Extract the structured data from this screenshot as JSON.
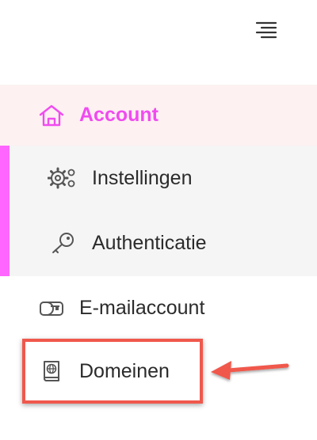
{
  "toggle": {
    "icon": "menu-lines-icon"
  },
  "nav": {
    "account": {
      "label": "Account",
      "icon": "home-icon",
      "color": "#f04cf0",
      "background": "#fdf1f1"
    },
    "submenu": {
      "active_bar_color": "#ff66ff",
      "items": [
        {
          "label": "Instellingen",
          "icon": "gears-icon"
        },
        {
          "label": "Authenticatie",
          "icon": "key-icon"
        }
      ]
    },
    "items": [
      {
        "label": "E-mailaccount",
        "icon": "mailbox-icon"
      },
      {
        "label": "Domeinen",
        "icon": "globe-book-icon"
      }
    ]
  },
  "annotation": {
    "highlight_color": "#f0584c",
    "target": "Domeinen"
  }
}
